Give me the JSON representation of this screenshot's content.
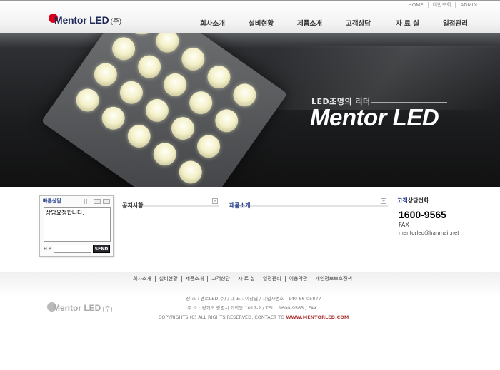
{
  "header": {
    "top_links": [
      "HOME",
      "비번조회",
      "ADMIN"
    ],
    "logo": {
      "name": "Mentor LED",
      "suffix": "(주)"
    },
    "nav": [
      "회사소개",
      "설비현황",
      "제품소개",
      "고객상담",
      "자 료 실",
      "일정관리"
    ]
  },
  "banner": {
    "tagline": "LED조명의 리더",
    "title": "Mentor LED"
  },
  "quick_consult": {
    "title": "빠른상담",
    "message": "상담요청합니다.",
    "hp_label": "H.P.",
    "hp_value": "",
    "send_label": "SEND"
  },
  "boards": {
    "notice_title": "공지사항",
    "products_title": "제품소개",
    "more_label": "+"
  },
  "call_center": {
    "title_part1": "고객",
    "title_part2": "상담전화",
    "phone": "1600-9565",
    "fax_label": "FAX",
    "email": "mentorled@hanmail.net"
  },
  "footer": {
    "nav": [
      "회사소개",
      "설비현황",
      "제품소개",
      "고객상담",
      "자 료 실",
      "일정관리",
      "이용약관",
      "개인정보보호정책"
    ],
    "logo": {
      "name": "Mentor LED",
      "suffix": "(주)"
    },
    "info_line1": "상 호 : 멘토LED(주) / 대 표 : 이상엽 / 사업자번호 : 140-86-05877",
    "info_line2": "주 소 : 경기도 광명시 가학동 1017-2 / TEL : 1600-9565 / FAX :",
    "copyright": "COPYRIGHTS (C) ALL RIGHTS RESERVED. CONTACT TO",
    "url": "WWW.MENTORLED.COM"
  }
}
